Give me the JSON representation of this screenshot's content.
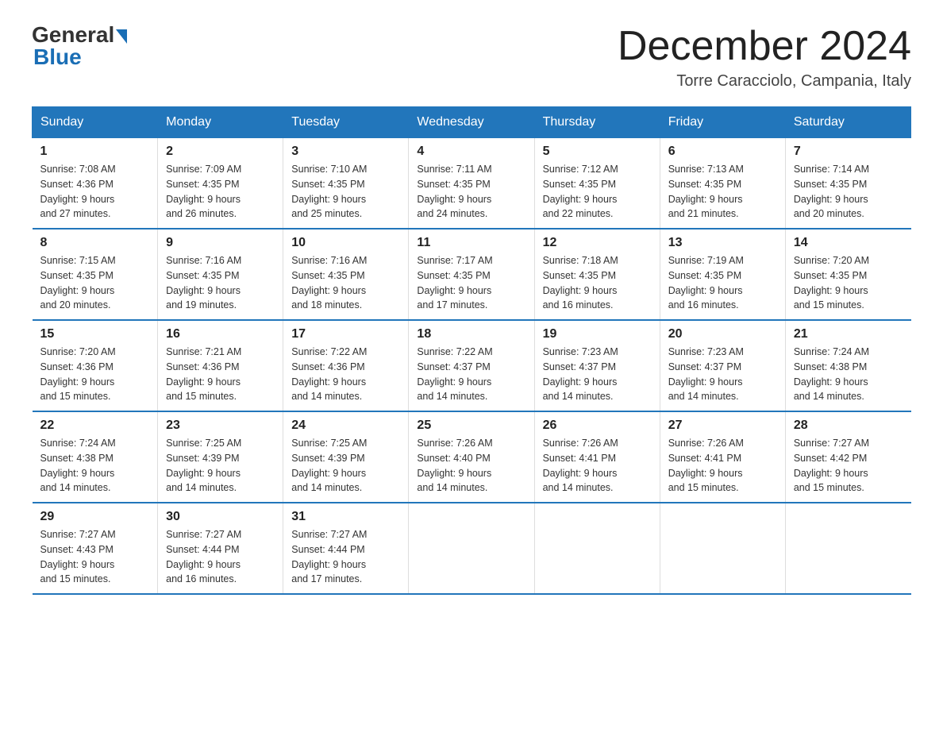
{
  "logo": {
    "general": "General",
    "blue": "Blue"
  },
  "header": {
    "month": "December 2024",
    "location": "Torre Caracciolo, Campania, Italy"
  },
  "days_of_week": [
    "Sunday",
    "Monday",
    "Tuesday",
    "Wednesday",
    "Thursday",
    "Friday",
    "Saturday"
  ],
  "weeks": [
    [
      {
        "day": "1",
        "sunrise": "7:08 AM",
        "sunset": "4:36 PM",
        "daylight": "9 hours and 27 minutes."
      },
      {
        "day": "2",
        "sunrise": "7:09 AM",
        "sunset": "4:35 PM",
        "daylight": "9 hours and 26 minutes."
      },
      {
        "day": "3",
        "sunrise": "7:10 AM",
        "sunset": "4:35 PM",
        "daylight": "9 hours and 25 minutes."
      },
      {
        "day": "4",
        "sunrise": "7:11 AM",
        "sunset": "4:35 PM",
        "daylight": "9 hours and 24 minutes."
      },
      {
        "day": "5",
        "sunrise": "7:12 AM",
        "sunset": "4:35 PM",
        "daylight": "9 hours and 22 minutes."
      },
      {
        "day": "6",
        "sunrise": "7:13 AM",
        "sunset": "4:35 PM",
        "daylight": "9 hours and 21 minutes."
      },
      {
        "day": "7",
        "sunrise": "7:14 AM",
        "sunset": "4:35 PM",
        "daylight": "9 hours and 20 minutes."
      }
    ],
    [
      {
        "day": "8",
        "sunrise": "7:15 AM",
        "sunset": "4:35 PM",
        "daylight": "9 hours and 20 minutes."
      },
      {
        "day": "9",
        "sunrise": "7:16 AM",
        "sunset": "4:35 PM",
        "daylight": "9 hours and 19 minutes."
      },
      {
        "day": "10",
        "sunrise": "7:16 AM",
        "sunset": "4:35 PM",
        "daylight": "9 hours and 18 minutes."
      },
      {
        "day": "11",
        "sunrise": "7:17 AM",
        "sunset": "4:35 PM",
        "daylight": "9 hours and 17 minutes."
      },
      {
        "day": "12",
        "sunrise": "7:18 AM",
        "sunset": "4:35 PM",
        "daylight": "9 hours and 16 minutes."
      },
      {
        "day": "13",
        "sunrise": "7:19 AM",
        "sunset": "4:35 PM",
        "daylight": "9 hours and 16 minutes."
      },
      {
        "day": "14",
        "sunrise": "7:20 AM",
        "sunset": "4:35 PM",
        "daylight": "9 hours and 15 minutes."
      }
    ],
    [
      {
        "day": "15",
        "sunrise": "7:20 AM",
        "sunset": "4:36 PM",
        "daylight": "9 hours and 15 minutes."
      },
      {
        "day": "16",
        "sunrise": "7:21 AM",
        "sunset": "4:36 PM",
        "daylight": "9 hours and 15 minutes."
      },
      {
        "day": "17",
        "sunrise": "7:22 AM",
        "sunset": "4:36 PM",
        "daylight": "9 hours and 14 minutes."
      },
      {
        "day": "18",
        "sunrise": "7:22 AM",
        "sunset": "4:37 PM",
        "daylight": "9 hours and 14 minutes."
      },
      {
        "day": "19",
        "sunrise": "7:23 AM",
        "sunset": "4:37 PM",
        "daylight": "9 hours and 14 minutes."
      },
      {
        "day": "20",
        "sunrise": "7:23 AM",
        "sunset": "4:37 PM",
        "daylight": "9 hours and 14 minutes."
      },
      {
        "day": "21",
        "sunrise": "7:24 AM",
        "sunset": "4:38 PM",
        "daylight": "9 hours and 14 minutes."
      }
    ],
    [
      {
        "day": "22",
        "sunrise": "7:24 AM",
        "sunset": "4:38 PM",
        "daylight": "9 hours and 14 minutes."
      },
      {
        "day": "23",
        "sunrise": "7:25 AM",
        "sunset": "4:39 PM",
        "daylight": "9 hours and 14 minutes."
      },
      {
        "day": "24",
        "sunrise": "7:25 AM",
        "sunset": "4:39 PM",
        "daylight": "9 hours and 14 minutes."
      },
      {
        "day": "25",
        "sunrise": "7:26 AM",
        "sunset": "4:40 PM",
        "daylight": "9 hours and 14 minutes."
      },
      {
        "day": "26",
        "sunrise": "7:26 AM",
        "sunset": "4:41 PM",
        "daylight": "9 hours and 14 minutes."
      },
      {
        "day": "27",
        "sunrise": "7:26 AM",
        "sunset": "4:41 PM",
        "daylight": "9 hours and 15 minutes."
      },
      {
        "day": "28",
        "sunrise": "7:27 AM",
        "sunset": "4:42 PM",
        "daylight": "9 hours and 15 minutes."
      }
    ],
    [
      {
        "day": "29",
        "sunrise": "7:27 AM",
        "sunset": "4:43 PM",
        "daylight": "9 hours and 15 minutes."
      },
      {
        "day": "30",
        "sunrise": "7:27 AM",
        "sunset": "4:44 PM",
        "daylight": "9 hours and 16 minutes."
      },
      {
        "day": "31",
        "sunrise": "7:27 AM",
        "sunset": "4:44 PM",
        "daylight": "9 hours and 17 minutes."
      },
      null,
      null,
      null,
      null
    ]
  ],
  "labels": {
    "sunrise": "Sunrise:",
    "sunset": "Sunset:",
    "daylight": "Daylight:"
  }
}
